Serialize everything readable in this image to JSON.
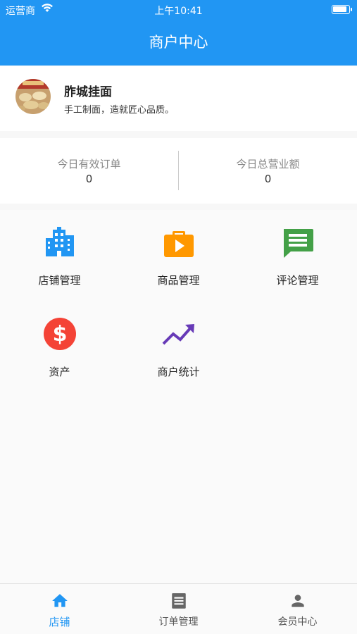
{
  "status_bar": {
    "carrier": "运营商",
    "time": "上午10:41",
    "battery_level": 0.9
  },
  "nav": {
    "title": "商户中心"
  },
  "merchant": {
    "name": "胙城挂面",
    "description": "手工制面，造就匠心品质。"
  },
  "stats": [
    {
      "label": "今日有效订单",
      "value": "0"
    },
    {
      "label": "今日总营业额",
      "value": "0"
    }
  ],
  "grid": [
    {
      "label": "店铺管理",
      "icon": "building-icon",
      "color": "#2196f3"
    },
    {
      "label": "商品管理",
      "icon": "product-play-bag-icon",
      "color": "#ff9800"
    },
    {
      "label": "评论管理",
      "icon": "comment-icon",
      "color": "#43a047"
    },
    {
      "label": "资产",
      "icon": "dollar-icon",
      "color": "#f44336"
    },
    {
      "label": "商户统计",
      "icon": "trending-up-icon",
      "color": "#673ab7"
    }
  ],
  "tabs": [
    {
      "label": "店铺",
      "icon": "home-icon",
      "active": true
    },
    {
      "label": "订单管理",
      "icon": "list-icon",
      "active": false
    },
    {
      "label": "会员中心",
      "icon": "person-icon",
      "active": false
    }
  ],
  "colors": {
    "primary": "#2196f3",
    "background": "#f7f7f7"
  }
}
